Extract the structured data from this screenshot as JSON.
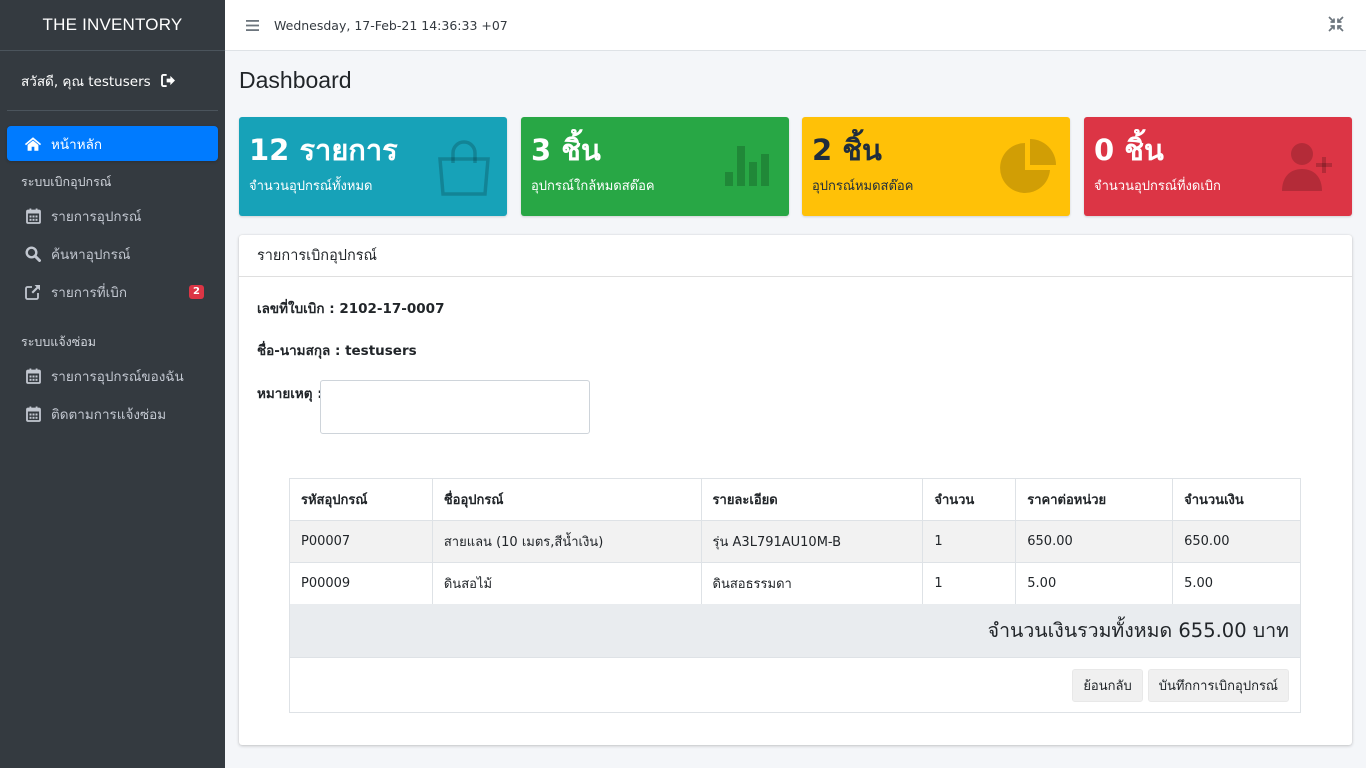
{
  "brand": "THE INVENTORY",
  "user": {
    "greeting": "สวัสดี, คุณ testusers",
    "logout_icon": "sign-out-icon"
  },
  "sidebar": {
    "home": {
      "label": "หน้าหลัก",
      "icon": "home-icon"
    },
    "section1": {
      "header": "ระบบเบิกอุปกรณ์",
      "items": [
        {
          "label": "รายการอุปกรณ์",
          "icon": "calendar-icon"
        },
        {
          "label": "ค้นหาอุปกรณ์",
          "icon": "search-icon"
        },
        {
          "label": "รายการที่เบิก",
          "icon": "external-link-icon",
          "badge": "2"
        }
      ]
    },
    "section2": {
      "header": "ระบบแจ้งซ่อม",
      "items": [
        {
          "label": "รายการอุปกรณ์ของฉัน",
          "icon": "calendar-icon"
        },
        {
          "label": "ติดตามการแจ้งซ่อม",
          "icon": "calendar-icon"
        }
      ]
    }
  },
  "topbar": {
    "datetime": "Wednesday, 17-Feb-21 14:36:33 +07",
    "menu_icon": "hamburger-icon",
    "fullscreen_icon": "compress-icon"
  },
  "page": {
    "title": "Dashboard"
  },
  "boxes": [
    {
      "value": "12 รายการ",
      "label": "จำนวนอุปกรณ์ทั้งหมด",
      "icon": "shopping-bag-icon",
      "color": "#17a2b8"
    },
    {
      "value": "3 ชิ้น",
      "label": "อุปกรณ์ใกล้หมดสต๊อค",
      "icon": "bar-chart-icon",
      "color": "#28a745"
    },
    {
      "value": "2 ชิ้น",
      "label": "อุปกรณ์หมดสต๊อค",
      "icon": "pie-chart-icon",
      "color": "#ffc107"
    },
    {
      "value": "0 ชิ้น",
      "label": "จำนวนอุปกรณ์ที่งดเบิก",
      "icon": "user-plus-icon",
      "color": "#dc3545"
    }
  ],
  "card": {
    "title": "รายการเบิกอุปกรณ์",
    "doc_no": "เลขที่ใบเบิก : 2102-17-0007",
    "name": "ชื่อ-นามสกุล : testusers",
    "remark_label": "หมายเหตุ :",
    "remark_value": ""
  },
  "table": {
    "headers": [
      "รหัสอุปกรณ์",
      "ชื่ออุปกรณ์",
      "รายละเอียด",
      "จำนวน",
      "ราคาต่อหน่วย",
      "จำนวนเงิน"
    ],
    "rows": [
      [
        "P00007",
        "สายแลน (10 เมตร,สีน้ำเงิน)",
        "รุ่น A3L791AU10M-B",
        "1",
        "650.00",
        "650.00"
      ],
      [
        "P00009",
        "ดินสอไม้",
        "ดินสอธรรมดา",
        "1",
        "5.00",
        "5.00"
      ]
    ],
    "total": "จำนวนเงินรวมทั้งหมด 655.00 บาท"
  },
  "buttons": {
    "back": "ย้อนกลับ",
    "save": "บันทึกการเบิกอุปกรณ์"
  }
}
